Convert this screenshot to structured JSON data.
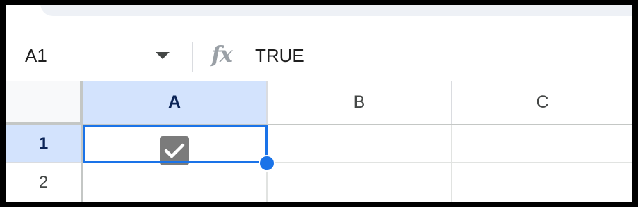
{
  "formula_bar": {
    "name_box": "A1",
    "fx_symbol": "fx",
    "value": "TRUE"
  },
  "columns": [
    "A",
    "B",
    "C"
  ],
  "rows": [
    "1",
    "2"
  ],
  "selected_cell": "A1",
  "cells": {
    "A1": {
      "type": "checkbox",
      "checked": true
    }
  },
  "colors": {
    "selection": "#1a73e8",
    "header_selected_bg": "#d3e3fd",
    "checkbox_fill": "#7b7b7b"
  },
  "icons": {
    "dropdown": "chevron-down-icon",
    "formula": "fx-icon",
    "checkbox": "checkmark-icon"
  }
}
